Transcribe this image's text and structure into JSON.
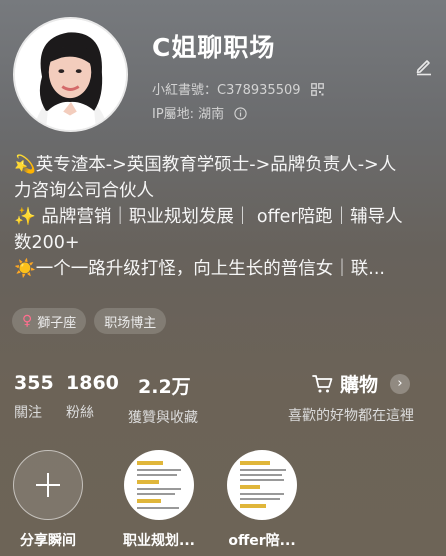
{
  "profile": {
    "name": "C姐聊职场",
    "xhs_id": "小紅書號：C378935509",
    "ip": "IP屬地: 湖南"
  },
  "bio": {
    "line1": "💫英专渣本->英国教育学硕士->品牌负责人->人",
    "line2": "力咨询公司合伙人",
    "line3": "✨ 品牌营销｜职业规划发展｜ offer陪跑｜辅导人",
    "line4": "数200+",
    "line5": "☀️一个一路升级打怪，向上生长的普信女｜联..."
  },
  "tags": {
    "zodiac": "獅子座",
    "venus_symbol": "♀",
    "occupation": "职场博主"
  },
  "stats": {
    "following": {
      "value": "355",
      "label": "關注"
    },
    "followers": {
      "value": "1860",
      "label": "粉絲"
    },
    "likes": {
      "value": "2.2万",
      "label": "獲贊與收藏"
    }
  },
  "shop": {
    "title": "購物",
    "subtitle": "喜歡的好物都在這裡",
    "chevron": "›"
  },
  "highlights": [
    {
      "label": "分享瞬间"
    },
    {
      "label": "职业规划..."
    },
    {
      "label": "offer陪..."
    }
  ],
  "icons": {
    "edit": "pencil-icon",
    "qr": "qr-code-icon",
    "info": "info-icon",
    "cart": "cart-icon",
    "add": "plus-icon"
  }
}
